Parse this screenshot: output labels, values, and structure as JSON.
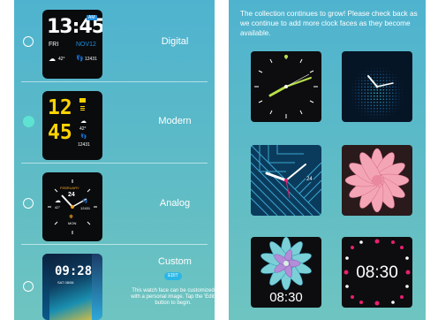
{
  "faces": [
    {
      "name": "Digital",
      "selected": false,
      "time_h": "13",
      "time_m": "45",
      "am": "AM",
      "day": "FRI",
      "date": "NOV12",
      "temp": "42°",
      "steps": "12431"
    },
    {
      "name": "Modern",
      "selected": true,
      "hour": "12",
      "minute": "45",
      "temp": "42°",
      "steps": "12431"
    },
    {
      "name": "Analog",
      "selected": false,
      "month": "FEBRUARY",
      "num": "24",
      "temp": "42°",
      "steps": "12431",
      "weekday": "MON"
    },
    {
      "name": "Custom",
      "selected": false,
      "time": "09:28",
      "subdate": "SAT 08/06",
      "edit_label": "EDIT",
      "description": "This watch face can be customized with a personal image. Tap the 'Edit' button to begin."
    }
  ],
  "gallery": {
    "intro": "The collection continues to grow! Please check back as we continue to add more clock faces as they become available.",
    "items": [
      {
        "id": "green-hands-analog"
      },
      {
        "id": "dotted-blue-analog"
      },
      {
        "id": "stripes-analog",
        "date": "24"
      },
      {
        "id": "pink-flower"
      },
      {
        "id": "lotus-digital",
        "time": "08:30"
      },
      {
        "id": "pink-dots-digital",
        "time": "08:30"
      }
    ]
  },
  "colors": {
    "accent": "#5ee3d2",
    "edit_button": "#2ab7e6",
    "digital_blue": "#1e8fe0",
    "modern_yellow": "#ffd400",
    "pink": "#e8206e",
    "lime": "#b8e04a"
  }
}
